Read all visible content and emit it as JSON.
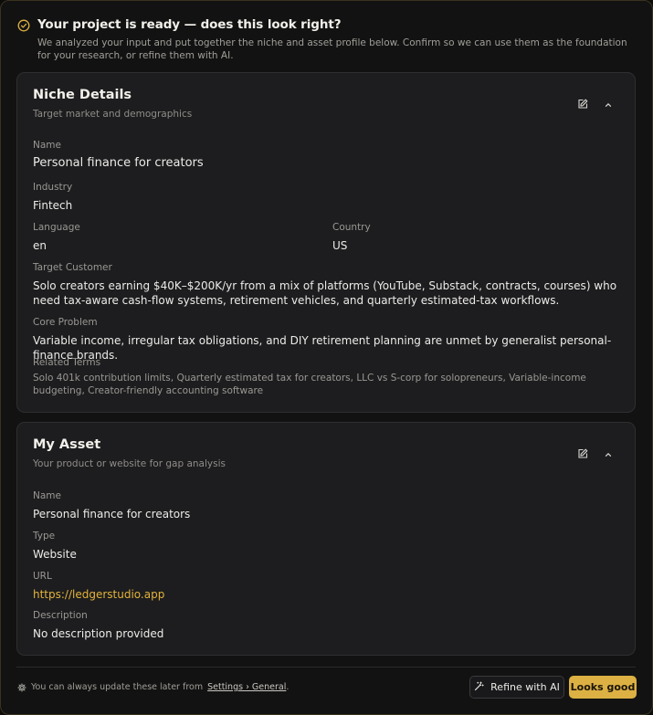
{
  "header": {
    "title": "Your project is ready — does this look right?",
    "subtitle": "We analyzed your input and put together the niche and asset profile below. Confirm so we can use them as the foundation for your research, or refine them with AI."
  },
  "niche": {
    "title": "Niche Details",
    "subtitle": "Target market and demographics",
    "name_label": "Name",
    "name_value": "Personal finance for creators",
    "industry_label": "Industry",
    "industry_value": "Fintech",
    "language_label": "Language",
    "language_value": "en",
    "country_label": "Country",
    "country_value": "US",
    "target_label": "Target Customer",
    "target_value": "Solo creators earning $40K–$200K/yr from a mix of platforms (YouTube, Substack, contracts, courses) who need tax-aware cash-flow systems, retirement vehicles, and quarterly estimated-tax workflows.",
    "problem_label": "Core Problem",
    "problem_value": "Variable income, irregular tax obligations, and DIY retirement planning are unmet by generalist personal-finance brands.",
    "terms_label": "Related Terms",
    "terms_value": "Solo 401k contribution limits, Quarterly estimated tax for creators, LLC vs S-corp for solopreneurs, Variable-income budgeting, Creator-friendly accounting software"
  },
  "asset": {
    "title": "My Asset",
    "subtitle": "Your product or website for gap analysis",
    "name_label": "Name",
    "name_value": "Personal finance for creators",
    "type_label": "Type",
    "type_value": "Website",
    "url_label": "URL",
    "url_value": "https://ledgerstudio.app",
    "desc_label": "Description",
    "desc_value": "No description provided"
  },
  "footer": {
    "note_prefix": "You can always update these later from",
    "note_link": "Settings › General",
    "note_suffix": ".",
    "refine_label": "Refine with AI",
    "confirm_label": "Looks good"
  },
  "colors": {
    "accent": "#dcb043",
    "link": "#e3b33a",
    "card_bg": "#1d1d1f",
    "page_bg": "#121212"
  },
  "icons": {
    "header": "check-circle-icon",
    "edit": "pencil-edit-icon",
    "collapse": "chevron-up-icon",
    "footer": "gear-icon",
    "refine": "magic-wand-icon"
  }
}
